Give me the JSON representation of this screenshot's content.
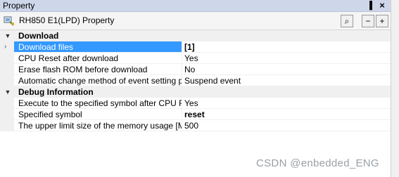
{
  "window": {
    "title": "Property",
    "pin_glyph": "▐",
    "close_glyph": "×"
  },
  "header": {
    "label": "RH850 E1(LPD) Property",
    "search_glyph": "⌕",
    "collapse_glyph": "−",
    "expand_glyph": "+"
  },
  "categories": [
    {
      "label": "Download",
      "toggle_glyph": "▼",
      "rows": [
        {
          "name": "Download files",
          "value": "[1]",
          "selected": true,
          "bold": true
        },
        {
          "name": "CPU Reset after download",
          "value": "Yes"
        },
        {
          "name": "Erase flash ROM before download",
          "value": "No"
        },
        {
          "name": "Automatic change method of event setting position",
          "value": "Suspend event"
        }
      ]
    },
    {
      "label": "Debug Information",
      "toggle_glyph": "▼",
      "rows": [
        {
          "name": "Execute to the specified symbol after CPU Reset",
          "value": "Yes"
        },
        {
          "name": "Specified symbol",
          "value": "reset",
          "bold": true
        },
        {
          "name": "The upper limit size of the memory usage [MByte]",
          "value": "500"
        }
      ]
    }
  ],
  "row_marker_glyph": "›",
  "watermark": "CSDN @enbedded_ENG"
}
